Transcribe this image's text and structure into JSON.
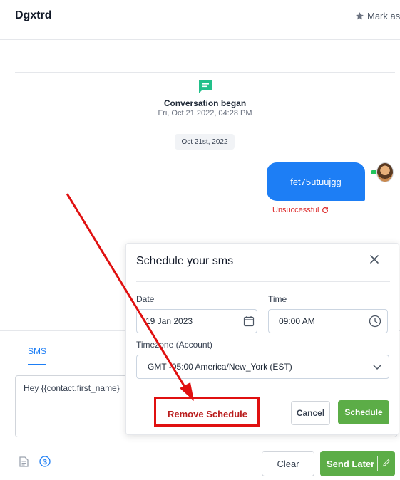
{
  "header": {
    "title": "Dgxtrd",
    "mark_as_label": "Mark as"
  },
  "conversation": {
    "began_label": "Conversation began",
    "began_time": "Fri, Oct 21 2022, 04:28 PM",
    "date_separator": "Oct 21st, 2022"
  },
  "message": {
    "text": "fet75utuujgg",
    "status": "Unsuccessful"
  },
  "compose": {
    "tab_label": "SMS",
    "message_text": "Hey {{contact.first_name}",
    "clear_label": "Clear",
    "send_later_label": "Send Later"
  },
  "schedule_modal": {
    "title": "Schedule your sms",
    "date_label": "Date",
    "date_value": "19 Jan 2023",
    "time_label": "Time",
    "time_value": "09:00 AM",
    "timezone_label": "Timezone (Account)",
    "timezone_value": "GMT -05:00 America/New_York (EST)",
    "remove_label": "Remove Schedule",
    "cancel_label": "Cancel",
    "schedule_label": "Schedule"
  },
  "icons": {
    "star": "star-icon",
    "chat": "chat-bubble-icon",
    "retry": "retry-icon",
    "calendar": "calendar-icon",
    "clock": "clock-icon",
    "chevron": "chevron-down-icon",
    "close": "close-icon",
    "document": "document-icon",
    "dollar": "dollar-icon",
    "pencil": "pencil-icon"
  },
  "colors": {
    "accent_blue": "#1d7ef5",
    "accent_green": "#5cad47",
    "error_red": "#dc2626",
    "annotation_red": "#e01010"
  }
}
